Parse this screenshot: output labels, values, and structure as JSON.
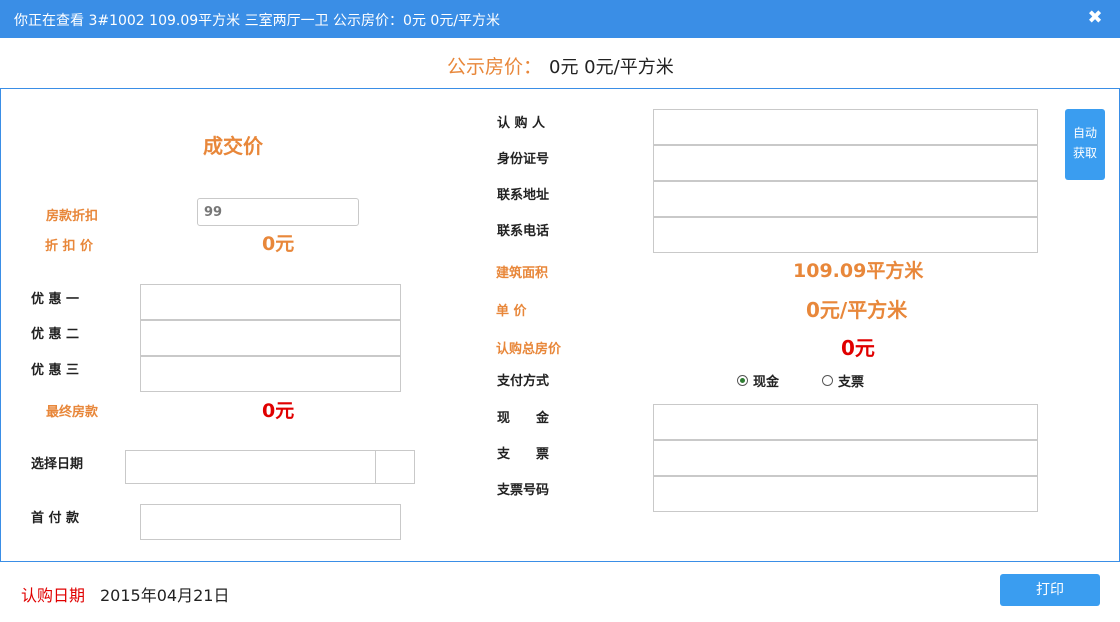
{
  "window": {
    "title": "你正在查看 3#1002 109.09平方米 三室两厅一卫 公示房价：0元 0元/平方米"
  },
  "header": {
    "label": "公示房价：",
    "value": "0元 0元/平方米"
  },
  "left": {
    "section_title": "成交价",
    "discount_label": "房款折扣",
    "discount_value": "99",
    "discount_price_label": "折 扣 价",
    "discount_price_value": "0元",
    "promo1_label": "优 惠 一",
    "promo2_label": "优 惠 二",
    "promo3_label": "优 惠 三",
    "final_price_label": "最终房款",
    "final_price_value": "0元",
    "date_label": "选择日期",
    "down_payment_label": "首 付 款"
  },
  "right": {
    "buyer_label": "认 购 人",
    "id_label": "身份证号",
    "address_label": "联系地址",
    "phone_label": "联系电话",
    "auto_button": [
      "自动",
      "获取"
    ],
    "area_label": "建筑面积",
    "area_value": "109.09平方米",
    "unit_price_label": "单 价",
    "unit_price_value": "0元/平方米",
    "total_label": "认购总房价",
    "total_value": "0元",
    "payment_label": "支付方式",
    "payment_options": [
      "现金",
      "支票"
    ],
    "payment_selected": "现金",
    "cash_label": "现　　金",
    "cheque_label": "支　　票",
    "cheque_no_label": "支票号码"
  },
  "footer": {
    "date_label": "认购日期",
    "date_value": "2015年04月21日",
    "print_label": "打印"
  },
  "colors": {
    "accent": "#3a8ee6",
    "label_orange": "#e8873a",
    "value_red": "#e00000"
  }
}
